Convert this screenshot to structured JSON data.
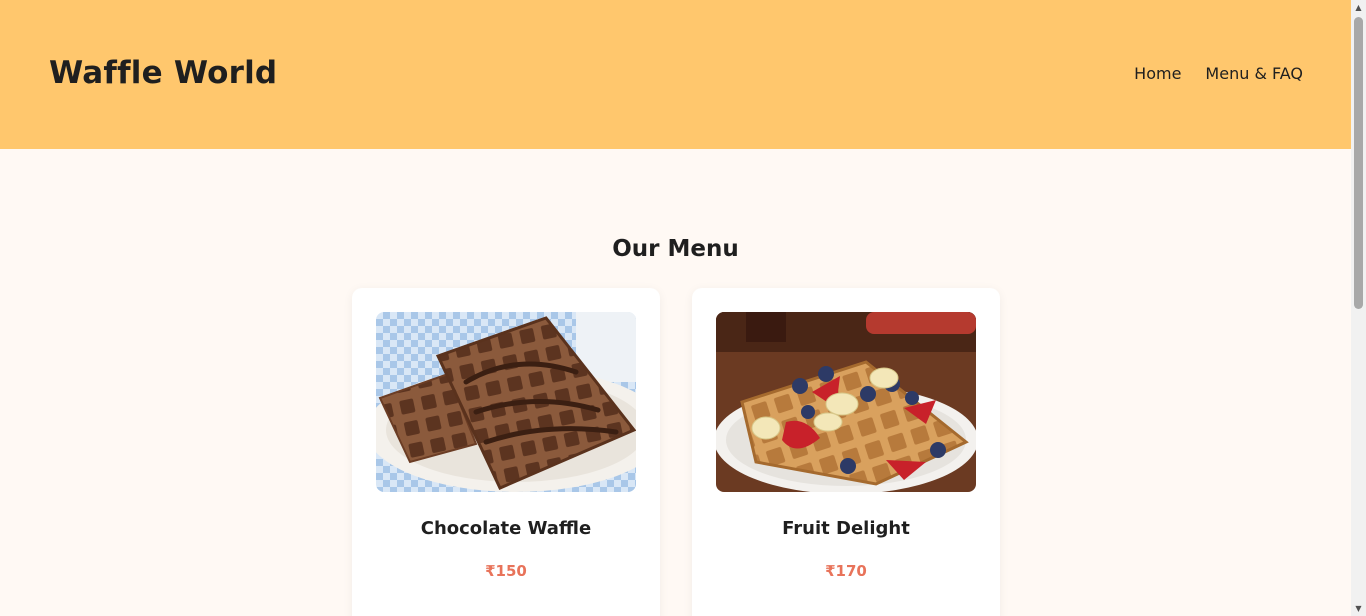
{
  "header": {
    "brand": "Waffle World",
    "nav": [
      {
        "label": "Home"
      },
      {
        "label": "Menu & FAQ"
      }
    ]
  },
  "menu": {
    "title": "Our Menu",
    "items": [
      {
        "name": "Chocolate Waffle",
        "price": "₹150",
        "image": "chocolate-waffle-photo"
      },
      {
        "name": "Fruit Delight",
        "price": "₹170",
        "image": "fruit-waffle-photo"
      }
    ]
  },
  "colors": {
    "header_bg": "#ffc76d",
    "page_bg": "#fff9f4",
    "price": "#e8735a",
    "text": "#1f1f1f"
  }
}
